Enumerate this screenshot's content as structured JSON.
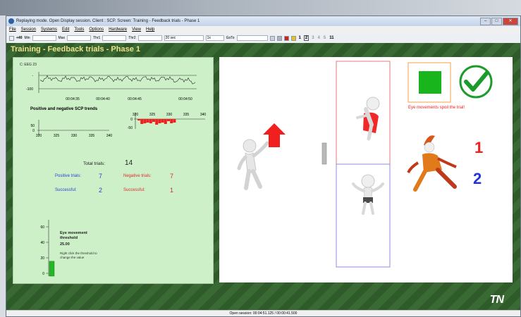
{
  "window": {
    "title": "Replaying mode. Open Display session. Client : SCP. Screen: Training - Feedback trials - Phase 1",
    "controls": [
      "minimize-icon",
      "maximize-icon",
      "close-icon"
    ]
  },
  "menu": [
    "File",
    "Session",
    "Systems",
    "Edit",
    "Tools",
    "Options",
    "Hardware",
    "View",
    "Help"
  ],
  "toolbar": {
    "value": "+40",
    "min_label": "Min",
    "max_label": "Max",
    "thr1_label": "Thr1",
    "thr2_label": "Thr2",
    "time_value": "20 sec",
    "speed_value": "1x",
    "goto_label": "GoTo",
    "numbers": [
      "1",
      "2",
      "3",
      "4",
      "5"
    ],
    "last_label": "11"
  },
  "screen_title": "Training - Feedback trials - Phase 1",
  "signal": {
    "channel": "C: EEG 23",
    "y_top": "-",
    "y_bottom": "-100",
    "times": [
      "00:04:35",
      "00:04:40",
      "00:04:45",
      "00:04:50"
    ]
  },
  "trends": {
    "title": "Positive and negative SCP trends",
    "pos_y": [
      "50",
      "0"
    ],
    "pos_x": [
      "320",
      "325",
      "330",
      "335",
      "340"
    ],
    "neg_x": [
      "320",
      "325",
      "330",
      "335",
      "340"
    ],
    "neg_y": [
      "0",
      "-50"
    ],
    "neg_bars": [
      2,
      7,
      6,
      5,
      6,
      4,
      8,
      6,
      5,
      7,
      3,
      6,
      5
    ]
  },
  "stats": {
    "total_label": "Total trials:",
    "total_value": "14",
    "positive_label": "Positive trials:",
    "positive_value": "7",
    "negative_label": "Negative trials:",
    "negative_value": "7",
    "pos_success_label": "Successful:",
    "pos_success_value": "2",
    "neg_success_label": "Successful:",
    "neg_success_value": "1"
  },
  "threshold": {
    "ticks": [
      "60",
      "40",
      "20",
      "0"
    ],
    "level_fraction": 0.26,
    "title": "Eye movement threshold",
    "value": "25.00",
    "hint": "Right click the threshold to change the value"
  },
  "feedback": {
    "warning": "Eye movements spoil the trial!",
    "number_one": "1",
    "number_two": "2",
    "accent_red": "#f21f1f",
    "accent_blue": "#2233dd",
    "accent_green": "#19b51d"
  },
  "status": "Open session: 00:04:51.125 / 00:00:41.500",
  "logo_text": "TN"
}
